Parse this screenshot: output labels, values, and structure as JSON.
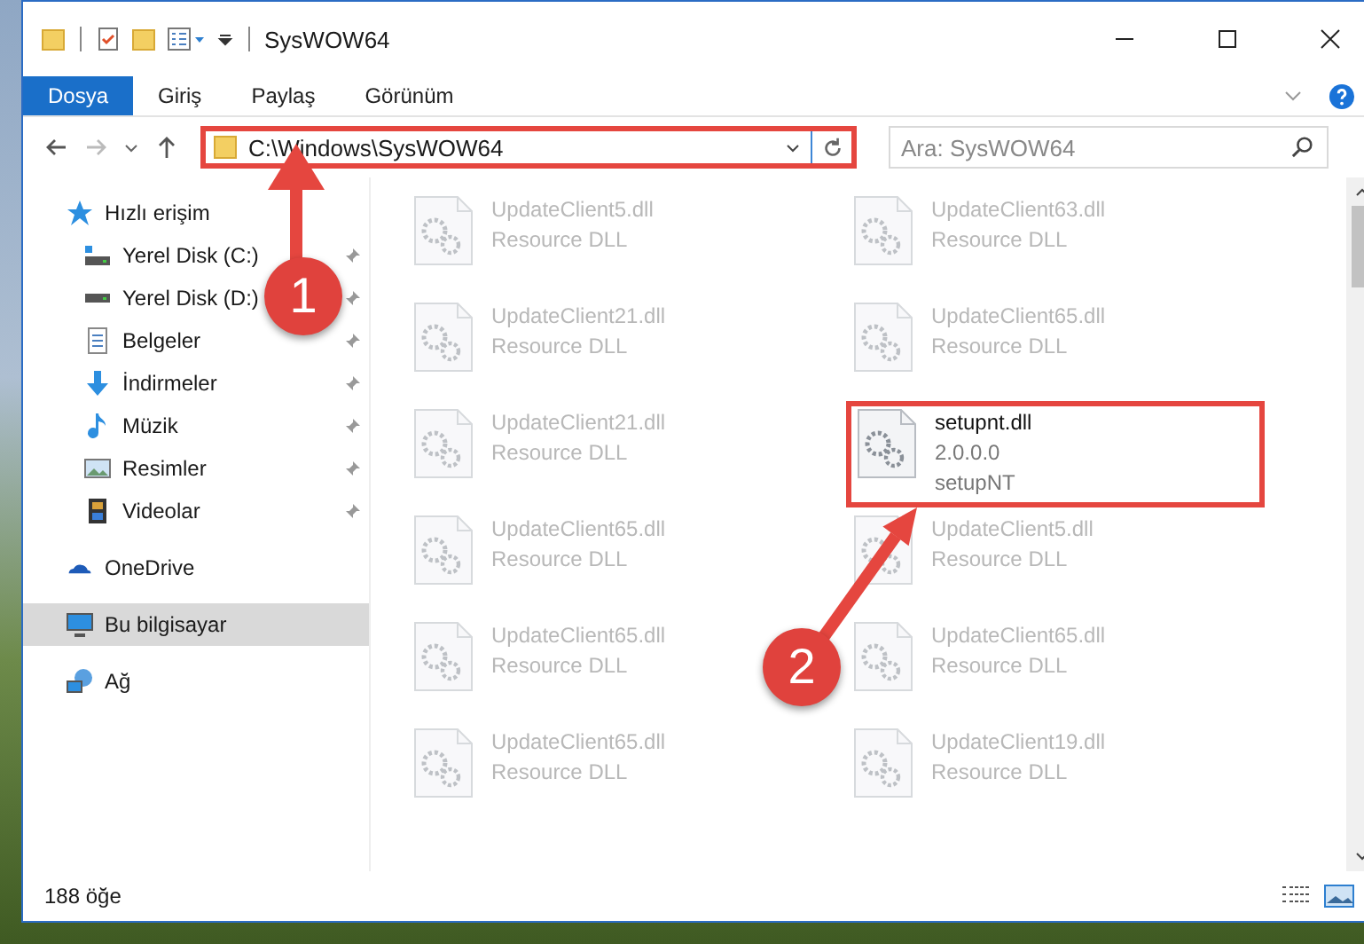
{
  "window": {
    "title": "SysWOW64"
  },
  "ribbon_tabs": [
    {
      "label": "Dosya",
      "selected": true
    },
    {
      "label": "Giriş",
      "selected": false
    },
    {
      "label": "Paylaş",
      "selected": false
    },
    {
      "label": "Görünüm",
      "selected": false
    }
  ],
  "address_bar": {
    "value": "C:\\Windows\\SysWOW64",
    "callout": "1"
  },
  "search": {
    "placeholder": "Ara: SysWOW64"
  },
  "sidebar": {
    "items": [
      {
        "label": "Hızlı erişim",
        "kind": "quick-access",
        "selected": false,
        "children": [
          {
            "label": "Yerel Disk (C:)",
            "kind": "system-drive",
            "pinned": true,
            "selected": false
          },
          {
            "label": "Yerel Disk (D:)",
            "kind": "drive",
            "pinned": true,
            "selected": false
          },
          {
            "label": "Belgeler",
            "kind": "documents",
            "pinned": true,
            "selected": false
          },
          {
            "label": "İndirmeler",
            "kind": "downloads",
            "pinned": true,
            "selected": false
          },
          {
            "label": "Müzik",
            "kind": "music",
            "pinned": true,
            "selected": false
          },
          {
            "label": "Resimler",
            "kind": "pictures",
            "pinned": true,
            "selected": false
          },
          {
            "label": "Videolar",
            "kind": "videos",
            "pinned": true,
            "selected": false
          }
        ]
      },
      {
        "label": "OneDrive",
        "kind": "cloud",
        "selected": false
      },
      {
        "label": "Bu bilgisayar",
        "kind": "computer",
        "selected": true
      },
      {
        "label": "Ağ",
        "kind": "network",
        "selected": false
      }
    ]
  },
  "files": [
    {
      "name": "UpdateClient5.dll",
      "details": [
        "Resource DLL"
      ],
      "blurred": true
    },
    {
      "name": "UpdateClient21.dll",
      "details": [
        "Resource DLL"
      ],
      "blurred": true
    },
    {
      "name": "UpdateClient21.dll",
      "details": [
        "Resource DLL"
      ],
      "blurred": true
    },
    {
      "name": "UpdateClient65.dll",
      "details": [
        "Resource DLL"
      ],
      "blurred": true
    },
    {
      "name": "UpdateClient65.dll",
      "details": [
        "Resource DLL"
      ],
      "blurred": true
    },
    {
      "name": "UpdateClient65.dll",
      "details": [
        "Resource DLL"
      ],
      "blurred": true
    },
    {
      "name": "UpdateClient63.dll",
      "details": [
        "Resource DLL"
      ],
      "blurred": true
    },
    {
      "name": "UpdateClient65.dll",
      "details": [
        "Resource DLL"
      ],
      "blurred": true
    },
    {
      "name": "setupnt.dll",
      "details": [
        "2.0.0.0",
        "setupNT"
      ],
      "blurred": false,
      "callout": "2"
    },
    {
      "name": "UpdateClient5.dll",
      "details": [
        "Resource DLL"
      ],
      "blurred": true
    },
    {
      "name": "UpdateClient65.dll",
      "details": [
        "Resource DLL"
      ],
      "blurred": true
    },
    {
      "name": "UpdateClient19.dll",
      "details": [
        "Resource DLL"
      ],
      "blurred": true
    }
  ],
  "status_bar": {
    "count": "188 öğe"
  }
}
